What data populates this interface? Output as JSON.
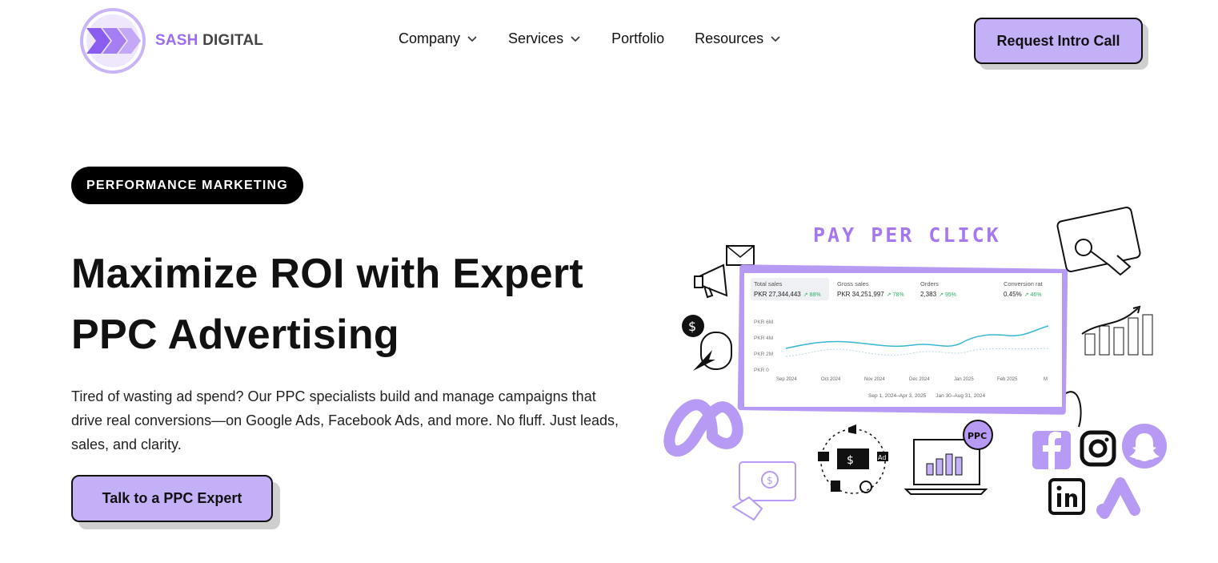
{
  "brand": {
    "name_part1": "SASH",
    "name_part2": "DIGITAL"
  },
  "nav": {
    "items": [
      {
        "label": "Company",
        "dropdown": true
      },
      {
        "label": "Services",
        "dropdown": true
      },
      {
        "label": "Portfolio",
        "dropdown": false
      },
      {
        "label": "Resources",
        "dropdown": true
      }
    ],
    "cta_label": "Request Intro Call"
  },
  "hero": {
    "badge": "PERFORMANCE MARKETING",
    "headline_line1": "Maximize ROI with Expert",
    "headline_line2": "PPC Advertising",
    "description": "Tired of wasting ad spend? Our PPC specialists build and manage campaigns that drive real conversions—on Google Ads, Facebook Ads, and more. No fluff. Just leads, sales, and clarity.",
    "cta_label": "Talk to a PPC Expert"
  },
  "illustration": {
    "title": "PAY PER CLICK",
    "kpis": [
      {
        "label": "Total sales",
        "value": "PKR 27,344,443",
        "change": "↗ 88%"
      },
      {
        "label": "Gross sales",
        "value": "PKR 34,251,997",
        "change": "↗ 78%"
      },
      {
        "label": "Orders",
        "value": "2,383",
        "change": "↗ 95%"
      },
      {
        "label": "Conversion rat",
        "value": "0.45%",
        "change": "↗ 46%"
      }
    ],
    "y_ticks": [
      "PKR 6M",
      "PKR 4M",
      "PKR 2M",
      "PKR 0"
    ],
    "x_ticks": [
      "Sep 2024",
      "Oct 2024",
      "Nov 2024",
      "Dec 2024",
      "Jan 2025",
      "Feb 2025",
      "M"
    ],
    "legend": [
      "Sep 1, 2024–Apr 3, 2025",
      "Jan 30–Aug 31, 2024"
    ],
    "ppc_bubble": "PPC",
    "accent": "#b69af3"
  },
  "colors": {
    "accent": "#c4b0f7",
    "brand_purple": "#9b6cf0",
    "dark": "#111111"
  }
}
